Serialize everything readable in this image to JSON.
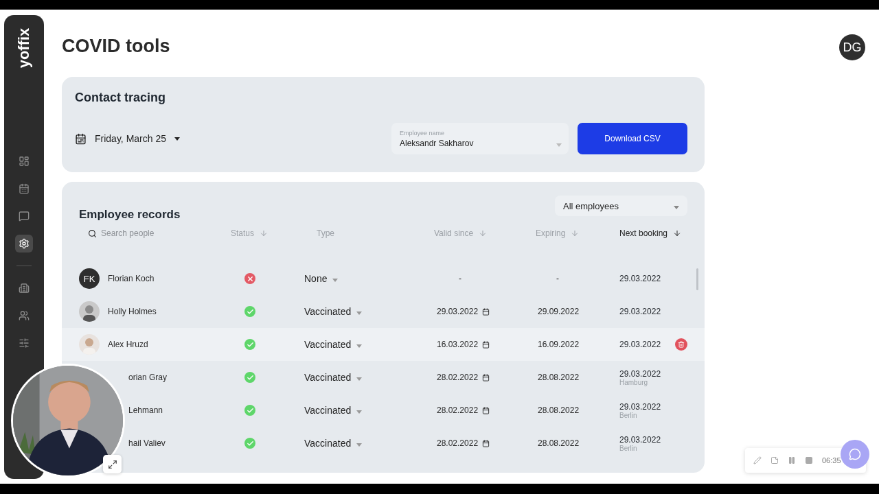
{
  "sidebar": {
    "logo": "yoffix",
    "main_items": [
      {
        "selected": false
      },
      {
        "selected": false
      },
      {
        "selected": false
      },
      {
        "selected": true
      }
    ],
    "admin_items": [
      {
        "selected": false
      },
      {
        "selected": false
      },
      {
        "selected": false
      }
    ]
  },
  "page": {
    "title": "COVID tools",
    "user_initials": "DG"
  },
  "contact_tracing": {
    "title": "Contact tracing",
    "date": "Friday, March 25",
    "employee_field": {
      "label": "Employee name",
      "value": "Aleksandr Sakharov"
    },
    "download_button": "Download CSV"
  },
  "employee_records": {
    "title": "Employee records",
    "filter": "All employees",
    "search": {
      "placeholder": "Search people"
    },
    "columns": [
      {
        "label": "Status",
        "sortable": true,
        "active": false
      },
      {
        "label": "Type",
        "sortable": false,
        "active": false
      },
      {
        "label": "Valid since",
        "sortable": true,
        "active": false
      },
      {
        "label": "Expiring",
        "sortable": true,
        "active": false
      },
      {
        "label": "Next booking",
        "sortable": true,
        "active": true
      }
    ],
    "rows": [
      {
        "avatar": {
          "kind": "initials",
          "initials": "FK"
        },
        "name": "Florian Koch",
        "valid": false,
        "type": "None",
        "valid_since": "-",
        "expiring": "-",
        "next_booking": "29.03.2022",
        "selected": false
      },
      {
        "name": "Holly Holmes",
        "valid": true,
        "type": "Vaccinated",
        "valid_since": "29.03.2022",
        "expiring": "29.09.2022",
        "next_booking": "29.03.2022",
        "selected": false
      },
      {
        "name": "Alex Hruzd",
        "valid": true,
        "type": "Vaccinated",
        "valid_since": "16.03.2022",
        "expiring": "16.09.2022",
        "next_booking": "29.03.2022",
        "selected": true
      },
      {
        "avatar": {
          "kind": "hidden"
        },
        "name": "orian Gray",
        "valid": true,
        "type": "Vaccinated",
        "valid_since": "28.02.2022",
        "expiring": "28.08.2022",
        "next_booking": "29.03.2022",
        "location": "Hamburg",
        "selected": false
      },
      {
        "avatar": {
          "kind": "hidden"
        },
        "name": "Lehmann",
        "valid": true,
        "type": "Vaccinated",
        "valid_since": "28.02.2022",
        "expiring": "28.08.2022",
        "next_booking": "29.03.2022",
        "location": "Berlin",
        "selected": false
      },
      {
        "avatar": {
          "kind": "hidden"
        },
        "name": "hail Valiev",
        "valid": true,
        "type": "Vaccinated",
        "valid_since": "28.02.2022",
        "expiring": "28.08.2022",
        "next_booking": "29.03.2022",
        "location": "Berlin",
        "selected": false
      }
    ]
  },
  "recorder": {
    "time": "06:35"
  }
}
